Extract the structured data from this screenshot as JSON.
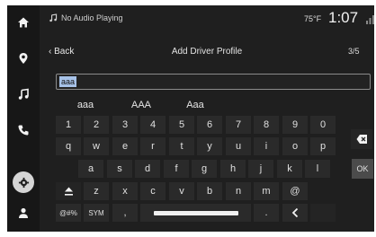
{
  "colors": {
    "panel": "#1c1c1c",
    "sidebar": "#171717",
    "key": "#2a2a2a",
    "ok_key": "#4b4b4b",
    "selection": "#a7c2e8"
  },
  "sidebar": {
    "items": [
      {
        "name": "home",
        "icon": "home-icon"
      },
      {
        "name": "navigation",
        "icon": "location-pin-icon"
      },
      {
        "name": "music",
        "icon": "music-note-icon"
      },
      {
        "name": "phone",
        "icon": "phone-icon"
      },
      {
        "name": "settings",
        "icon": "gear-icon",
        "active": true
      },
      {
        "name": "profile",
        "icon": "person-icon"
      }
    ]
  },
  "status": {
    "media_text": "No Audio Playing",
    "temperature": "75°F",
    "clock": "1:07"
  },
  "header": {
    "back_label": "Back",
    "title": "Add Driver Profile",
    "page_count": "3/5"
  },
  "input": {
    "value": "aaa"
  },
  "suggestions": [
    "aaa",
    "AAA",
    "Aaa"
  ],
  "keyboard": {
    "row1": [
      "1",
      "2",
      "3",
      "4",
      "5",
      "6",
      "7",
      "8",
      "9",
      "0"
    ],
    "row2": [
      "q",
      "w",
      "e",
      "r",
      "t",
      "y",
      "u",
      "i",
      "o",
      "p"
    ],
    "row3": [
      "a",
      "s",
      "d",
      "f",
      "g",
      "h",
      "j",
      "k",
      "l"
    ],
    "row3_ok": "OK",
    "row4": [
      "z",
      "x",
      "c",
      "v",
      "b",
      "n",
      "m",
      "@"
    ],
    "row5_symbols": "@#%",
    "row5_sym": "SYM",
    "row5_comma": ",",
    "row5_period": "."
  }
}
